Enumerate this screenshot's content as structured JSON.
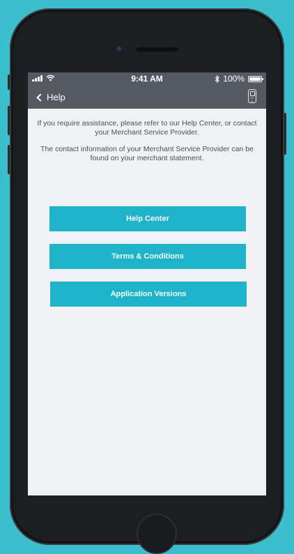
{
  "status_bar": {
    "time": "9:41 AM",
    "battery_text": "100%",
    "battery_level": 1.0,
    "icons": [
      "signal-icon",
      "wifi-icon",
      "bluetooth-icon",
      "battery-icon"
    ]
  },
  "nav": {
    "back_label": "Help",
    "back_icon": "chevron-left-icon",
    "device_icon": "card-reader-icon",
    "background_color": "#555a62"
  },
  "content": {
    "intro_text": "If you require assistance, please refer to our Help Center, or contact your Merchant Service Provider.",
    "contact_text": "The contact information of your Merchant Service Provider can be found on your merchant statement."
  },
  "buttons": {
    "help_center": "Help Center",
    "terms": "Terms & Conditions",
    "versions": "Application Versions",
    "accent_color": "#1db3c9"
  }
}
